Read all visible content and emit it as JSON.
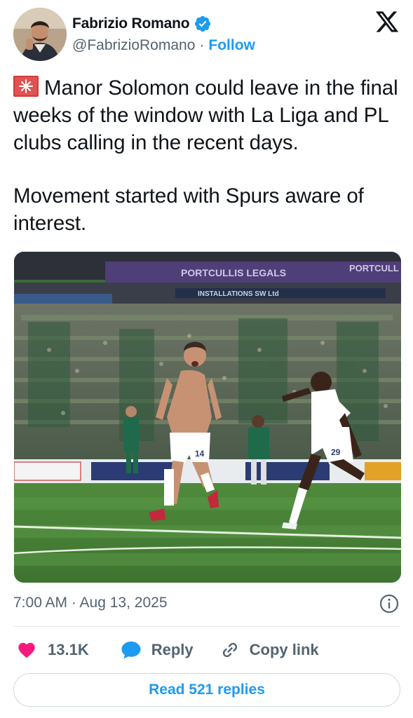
{
  "author": {
    "display_name": "Fabrizio Romano",
    "handle": "@FabrizioRomano",
    "separator": "·",
    "follow_label": "Follow"
  },
  "tweet": {
    "paragraph1": "Manor Solomon could leave in the final weeks of the window with La Liga and PL clubs calling in the recent days.",
    "paragraph2": "Movement started with Spurs aware of interest.",
    "emoji_icon": "rotating-light-icon"
  },
  "media": {
    "banner_left": "PORTCULLIS LEGALS",
    "banner_right": "PORTCULL",
    "board_text": "INSTALLATIONS SW Ltd",
    "player1_number": "14",
    "player2_number": "29"
  },
  "meta": {
    "timestamp": "7:00 AM · Aug 13, 2025"
  },
  "actions": {
    "like_count": "13.1K",
    "reply_label": "Reply",
    "copy_label": "Copy link"
  },
  "read_replies_label": "Read 521 replies",
  "colors": {
    "accent": "#1d9bf0",
    "like": "#f91880",
    "text": "#0f1419",
    "muted": "#536471"
  }
}
